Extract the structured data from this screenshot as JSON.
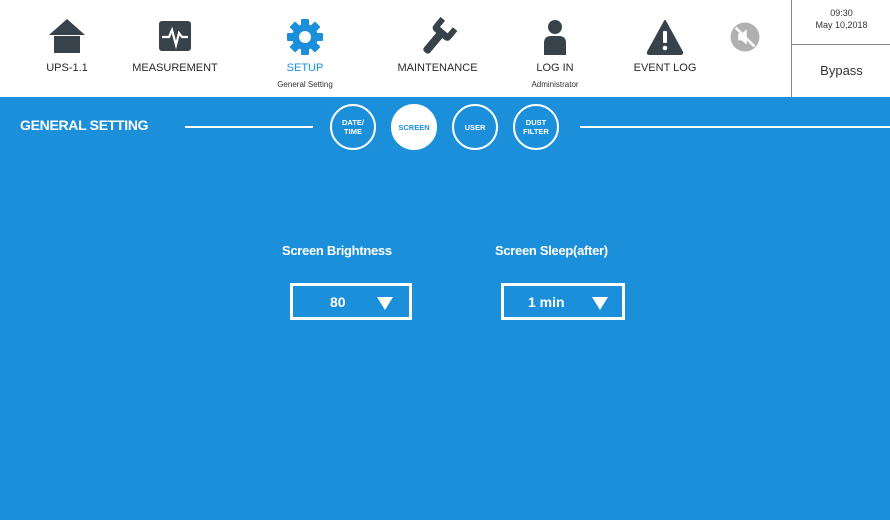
{
  "nav": {
    "items": [
      {
        "label": "UPS-1.1",
        "sub": "",
        "icon": "home-icon"
      },
      {
        "label": "MEASUREMENT",
        "sub": "",
        "icon": "pulse-monitor-icon"
      },
      {
        "label": "SETUP",
        "sub": "General Setting",
        "icon": "gear-icon"
      },
      {
        "label": "MAINTENANCE",
        "sub": "",
        "icon": "wrench-icon"
      },
      {
        "label": "LOG IN",
        "sub": "Administrator",
        "icon": "user-icon"
      },
      {
        "label": "EVENT LOG",
        "sub": "",
        "icon": "warning-icon"
      }
    ],
    "active_index": 2,
    "mute_icon": "mute-icon"
  },
  "status": {
    "time": "09:30",
    "date": "May 10,2018",
    "mode": "Bypass"
  },
  "section": {
    "title": "GENERAL SETTING"
  },
  "tabs": [
    {
      "label": "DATE/\nTIME",
      "active": false
    },
    {
      "label": "SCREEN",
      "active": true
    },
    {
      "label": "USER",
      "active": false
    },
    {
      "label": "DUST\nFILTER",
      "active": false
    }
  ],
  "settings": {
    "brightness": {
      "label": "Screen Brightness",
      "value": "80"
    },
    "sleep": {
      "label": "Screen Sleep(after)",
      "value": "1 min"
    }
  },
  "colors": {
    "accent": "#1b8fd9",
    "icon": "#37424a",
    "active_label": "#1a8fe0",
    "mute_icon": "#b0b0b0"
  }
}
